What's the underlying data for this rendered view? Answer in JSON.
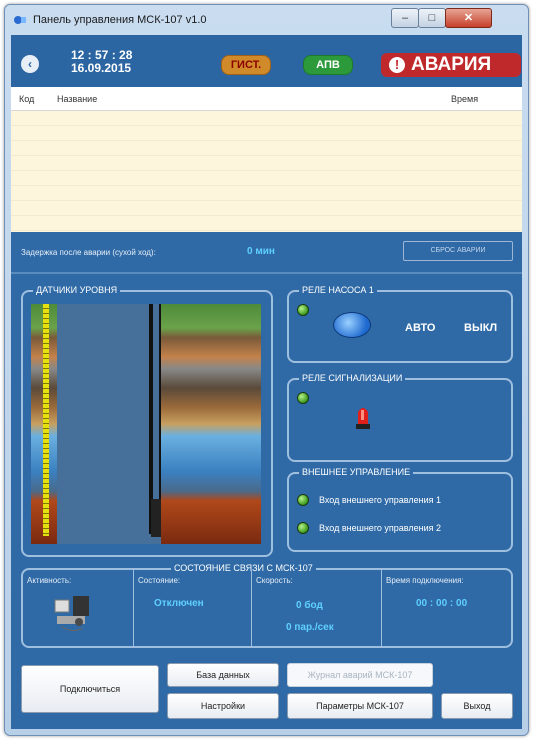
{
  "window": {
    "title": "Панель управления МСК-107 v1.0",
    "min": "–",
    "max": "□",
    "close": "✕"
  },
  "header": {
    "time": "12 : 57 : 28",
    "date": "16.09.2015",
    "gist": "ГИСТ.",
    "apv": "АПВ",
    "alarm": "АВАРИЯ",
    "alarm_icon": "!"
  },
  "log": {
    "col_code": "Код",
    "col_name": "Название",
    "col_time": "Время"
  },
  "delay": {
    "label": "Задержка после аварии (сухой ход):",
    "value": "0 мин",
    "reset": "СБРОС АВАРИИ"
  },
  "sensors": {
    "title": "ДАТЧИКИ УРОВНЯ"
  },
  "pump": {
    "title": "РЕЛЕ НАСОСА 1",
    "auto": "АВТО",
    "off": "ВЫКЛ"
  },
  "signal": {
    "title": "РЕЛЕ СИГНАЛИЗАЦИИ"
  },
  "ext": {
    "title": "ВНЕШНЕЕ УПРАВЛЕНИЕ",
    "input1": "Вход внешнего управления 1",
    "input2": "Вход внешнего управления 2"
  },
  "conn": {
    "title": "СОСТОЯНИЕ СВЯЗИ С МСК-107",
    "activity": "Активность:",
    "state_label": "Состояние:",
    "state": "Отключен",
    "speed_label": "Скорость:",
    "speed_baud": "0 бод",
    "speed_packets": "0 пар./сек",
    "time_label": "Время подключения:",
    "time": "00 : 00 : 00"
  },
  "buttons": {
    "connect": "Подключиться",
    "db": "База данных",
    "journal": "Журнал аварий МСК-107",
    "settings": "Настройки",
    "params": "Параметры МСК-107",
    "exit": "Выход"
  },
  "colors": {
    "panel": "#2f6aa6",
    "alarm": "#c0292c",
    "value": "#5fd0ff",
    "led": "#3a9a1a"
  }
}
